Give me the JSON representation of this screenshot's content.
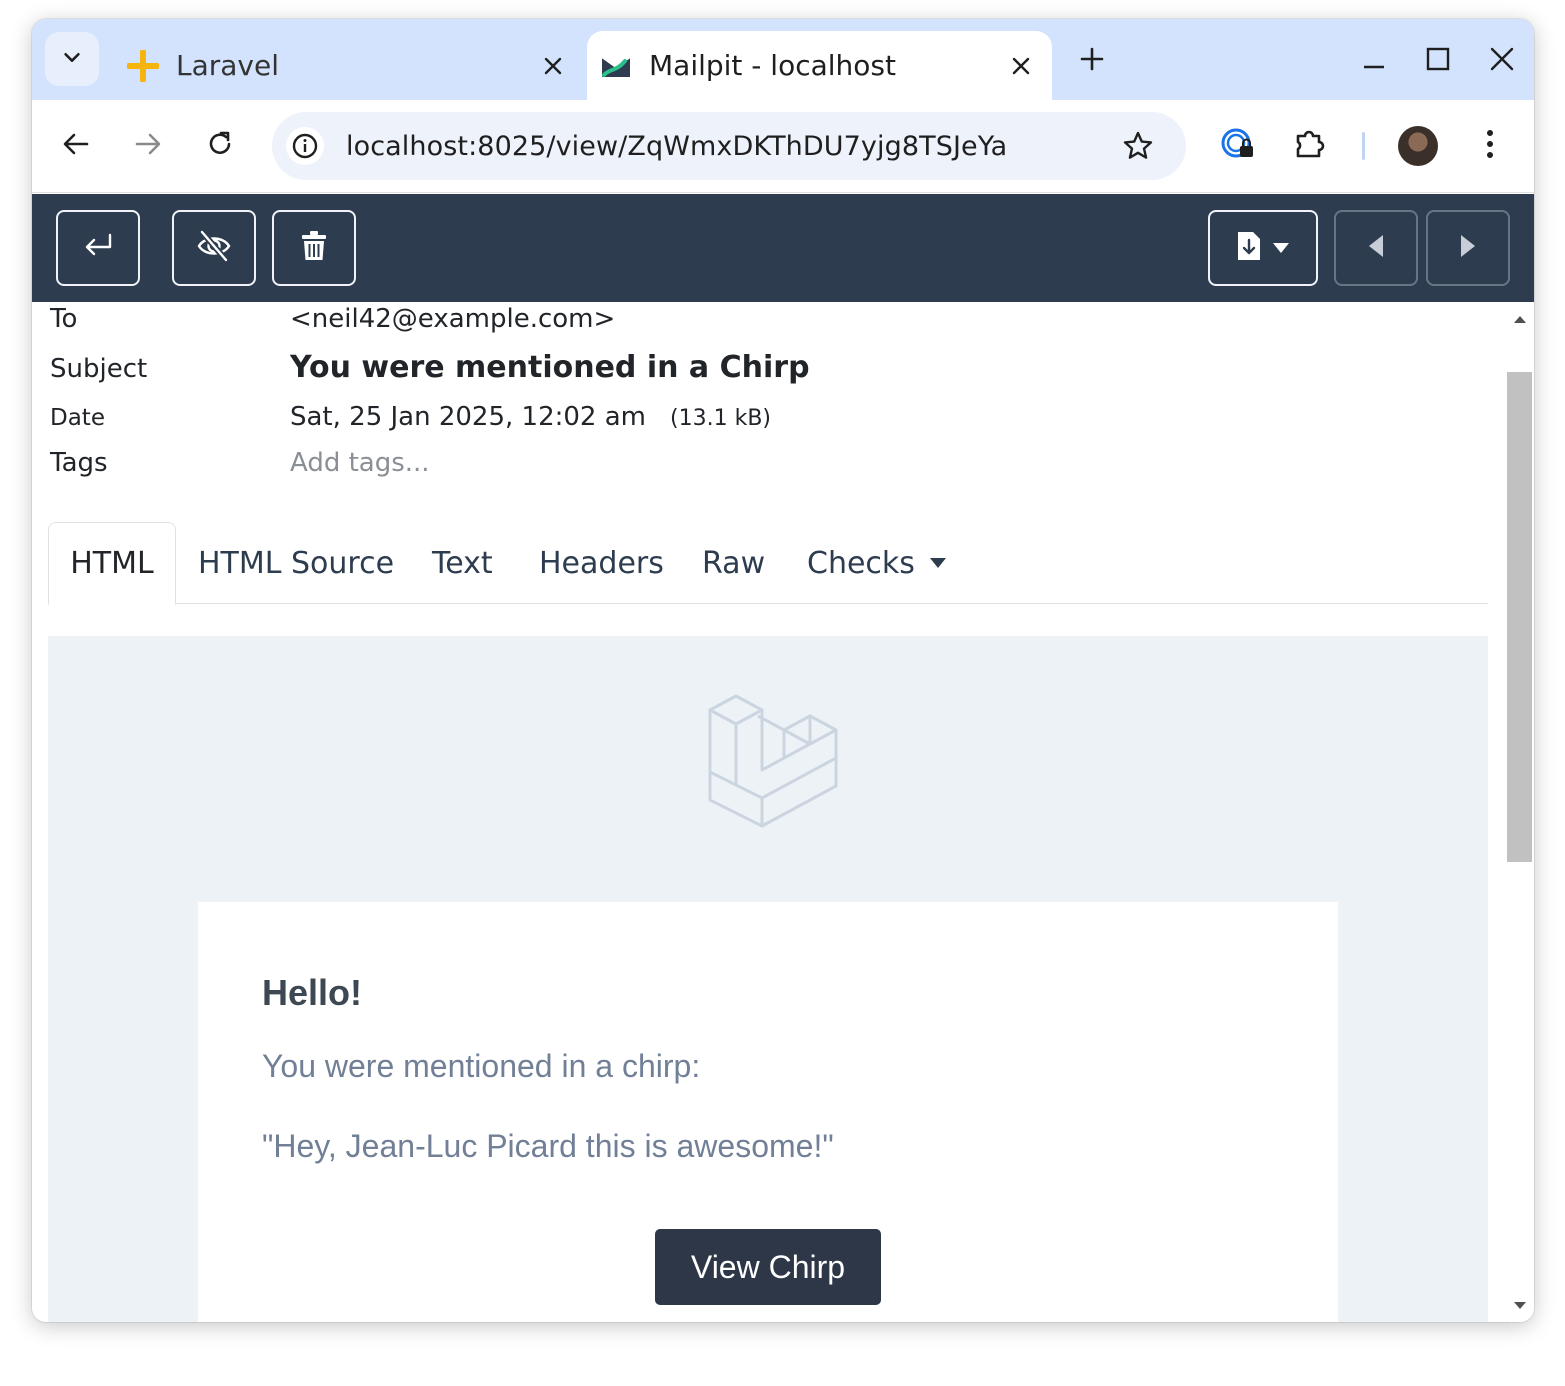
{
  "browser": {
    "tabs": [
      {
        "title": "Laravel",
        "active": false,
        "favicon": "sparkle-icon"
      },
      {
        "title": "Mailpit - localhost",
        "active": true,
        "favicon": "mailpit-icon"
      }
    ],
    "url": "localhost:8025/view/ZqWmxDKThDU7yjg8TSJeYa"
  },
  "colors": {
    "tabstrip": "#d3e3fd",
    "app_bar": "#2d3c4f",
    "email_bg": "#edf2f7",
    "button_dark": "#2d3748",
    "muted_text": "#718096"
  },
  "message": {
    "to_label": "To",
    "to_value": "<neil42@example.com>",
    "subject_label": "Subject",
    "subject_value": "You were mentioned in a Chirp",
    "date_label": "Date",
    "date_value": "Sat, 25 Jan 2025, 12:02 am",
    "size": "(13.1 kB)",
    "tags_label": "Tags",
    "tags_placeholder": "Add tags..."
  },
  "view_tabs": [
    "HTML",
    "HTML Source",
    "Text",
    "Headers",
    "Raw",
    "Checks"
  ],
  "email": {
    "greeting": "Hello!",
    "line1": "You were mentioned in a chirp:",
    "line2": "\"Hey, Jean-Luc Picard this is awesome!\"",
    "button": "View Chirp"
  }
}
